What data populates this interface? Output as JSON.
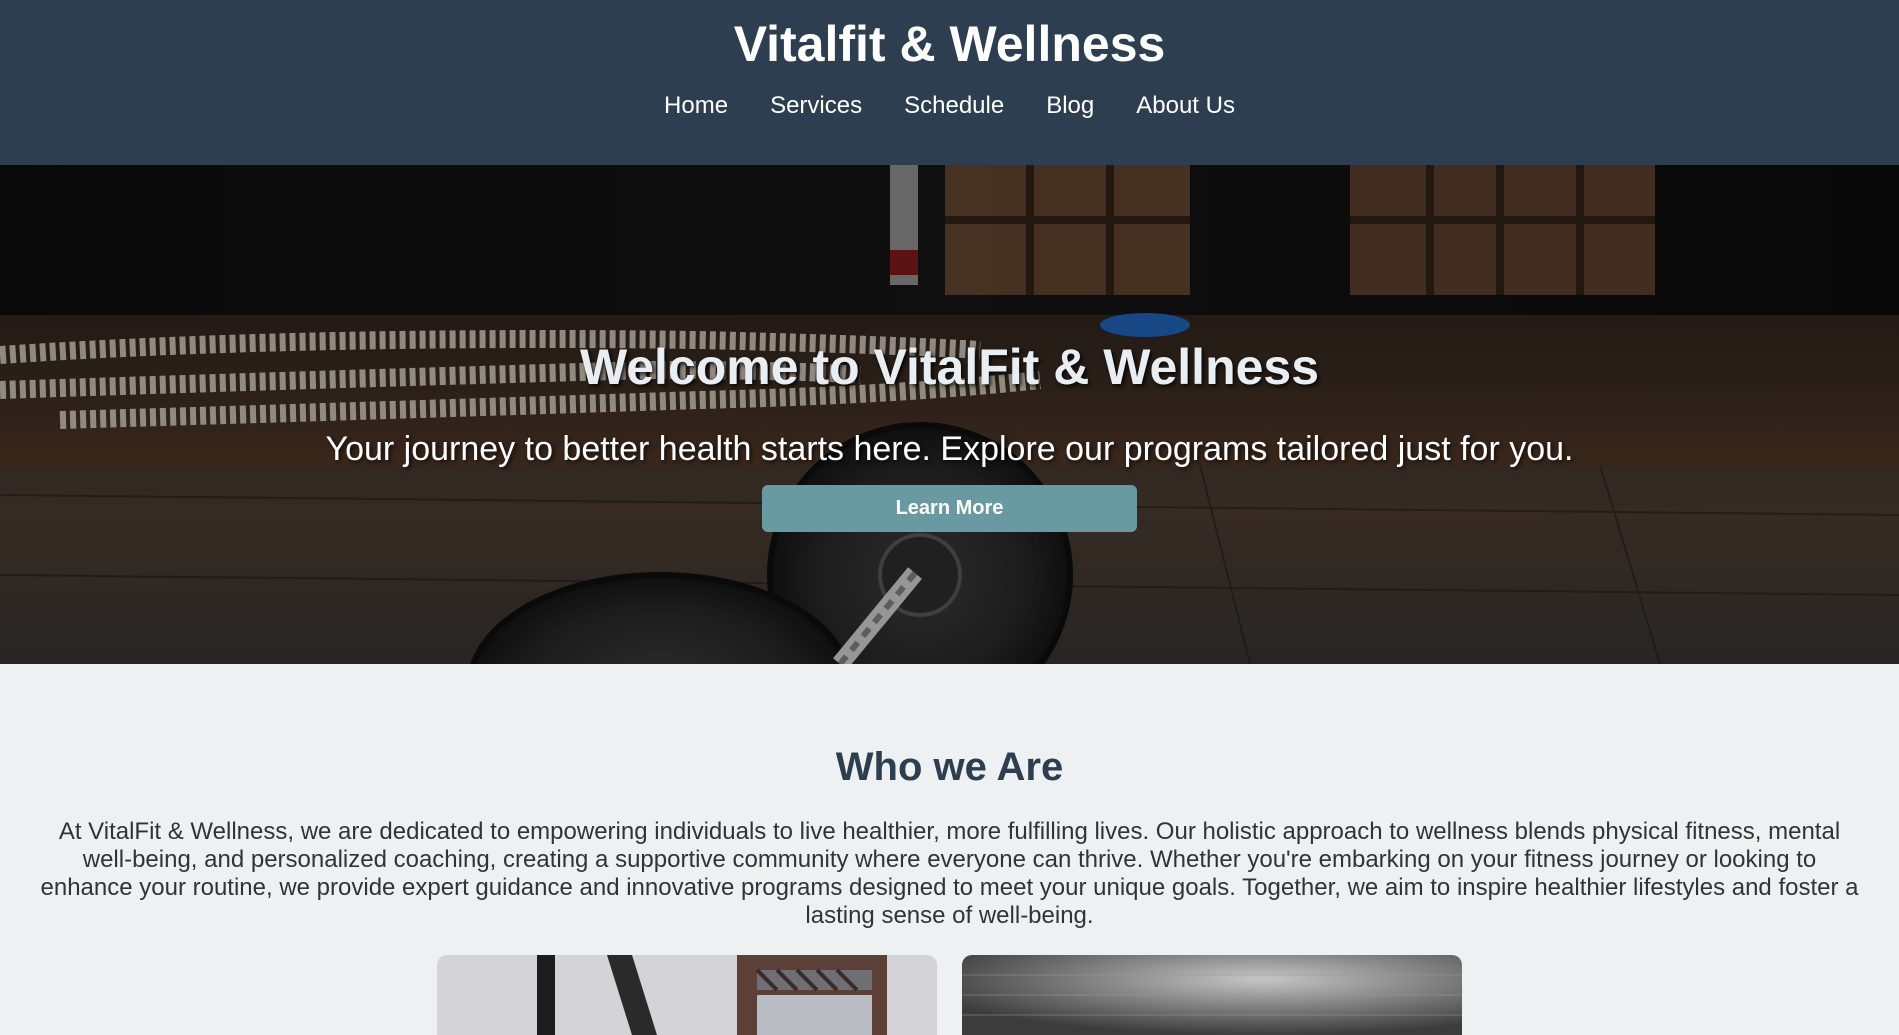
{
  "header": {
    "title": "Vitalfit & Wellness",
    "nav": [
      "Home",
      "Services",
      "Schedule",
      "Blog",
      "About Us"
    ]
  },
  "hero": {
    "heading": "Welcome to VitalFit & Wellness",
    "subtext": "Your journey to better health starts here. Explore our programs tailored just for you.",
    "button_label": "Learn More"
  },
  "about": {
    "heading": "Who we Are",
    "text": "At VitalFit & Wellness, we are dedicated to empowering individuals to live healthier, more fulfilling lives. Our holistic approach to wellness blends physical fitness, mental well-being, and personalized coaching, creating a supportive community where everyone can thrive. Whether you're embarking on your fitness journey or looking to enhance your routine, we provide expert guidance and innovative programs designed to meet your unique goals. Together, we aim to inspire healthier lifestyles and foster a lasting sense of well-being."
  },
  "colors": {
    "header_bg": "#2c3e50",
    "button_bg": "#6a9aa1",
    "page_bg": "#eef1f2",
    "heading_text": "#2c3e50"
  }
}
